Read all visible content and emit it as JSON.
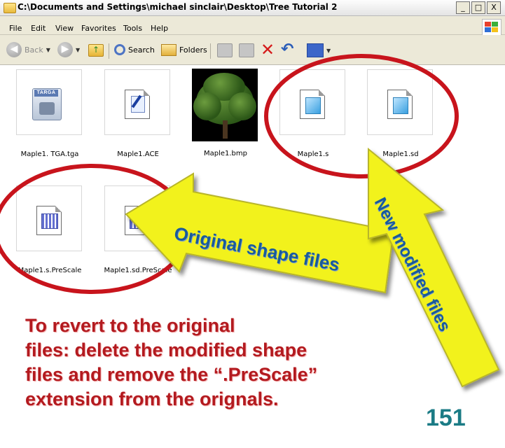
{
  "window": {
    "title": "C:\\Documents and Settings\\michael sinclair\\Desktop\\Tree Tutorial 2",
    "controls": [
      "_",
      "□",
      "X"
    ]
  },
  "menu": [
    "File",
    "Edit",
    "View",
    "Favorites",
    "Tools",
    "Help"
  ],
  "toolbar": {
    "back": "Back",
    "search": "Search",
    "folders": "Folders"
  },
  "files": [
    {
      "name": "Maple1. TGA.tga",
      "icon": "targa-image-icon",
      "thumb_label": "TARGA"
    },
    {
      "name": "Maple1.ACE",
      "icon": "ace-document-icon"
    },
    {
      "name": "Maple1.bmp",
      "icon": "tree-thumbnail"
    },
    {
      "name": "Maple1.s",
      "icon": "shape-file-icon"
    },
    {
      "name": "Maple1.sd",
      "icon": "shape-file-icon"
    },
    {
      "name": "Maple1.s.PreScale",
      "icon": "prescale-file-icon"
    },
    {
      "name": "Maple1.sd.PreScale",
      "icon": "prescale-file-icon"
    }
  ],
  "annotations": {
    "arrow_original": "Original shape files",
    "arrow_new": "New modified files",
    "note_lines": [
      "To revert to the original",
      "files: delete the modified shape",
      "files and remove the  “.PreScale”",
      "extension from the orignals."
    ],
    "page_number": "151"
  },
  "colors": {
    "ellipse": "#c8141c",
    "arrow_fill": "#f2f21c",
    "note_text": "#b31a1f",
    "page_number": "#1b7b85",
    "arrow_text": "#1a5b9a"
  }
}
